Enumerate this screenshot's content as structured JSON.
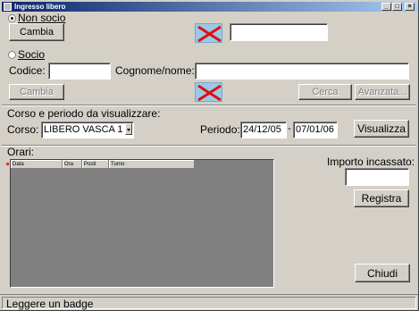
{
  "window": {
    "title": "Ingresso libero",
    "controls": {
      "minimize": "_",
      "maximize": "□",
      "close": "×"
    }
  },
  "non_socio": {
    "radio_label": "Non socio",
    "selected": true,
    "change_button": "Cambia",
    "image_icon": "broken-image-icon",
    "text_value": ""
  },
  "socio": {
    "radio_label": "Socio",
    "selected": false,
    "code_label": "Codice:",
    "code_value": "",
    "name_label": "Cognome/nome:",
    "name_value": "",
    "change_button": "Cambia",
    "search_button": "Cerca",
    "advanced_button": "Avanzata...",
    "image_icon": "broken-image-icon"
  },
  "corso_periodo": {
    "section_title": "Corso e periodo da visualizzare:",
    "course_label": "Corso:",
    "course_value": "LIBERO VASCA 1",
    "period_label": "Periodo:",
    "date_from": "24/12/05",
    "separator": "-",
    "date_to": "07/01/06",
    "show_button": "Visualizza"
  },
  "orari": {
    "section_title": "Orari:",
    "columns": [
      "Data",
      "Ora",
      "Posti",
      "Turno"
    ],
    "rows": []
  },
  "incasso": {
    "label": "Importo incassato:",
    "value": "",
    "register_button": "Registra"
  },
  "close_button": "Chiudi",
  "status": "Leggere un badge",
  "colors": {
    "title_start": "#0a246a",
    "title_end": "#a6caf0",
    "face": "#d4d0c8",
    "grid_bg": "#808080"
  }
}
